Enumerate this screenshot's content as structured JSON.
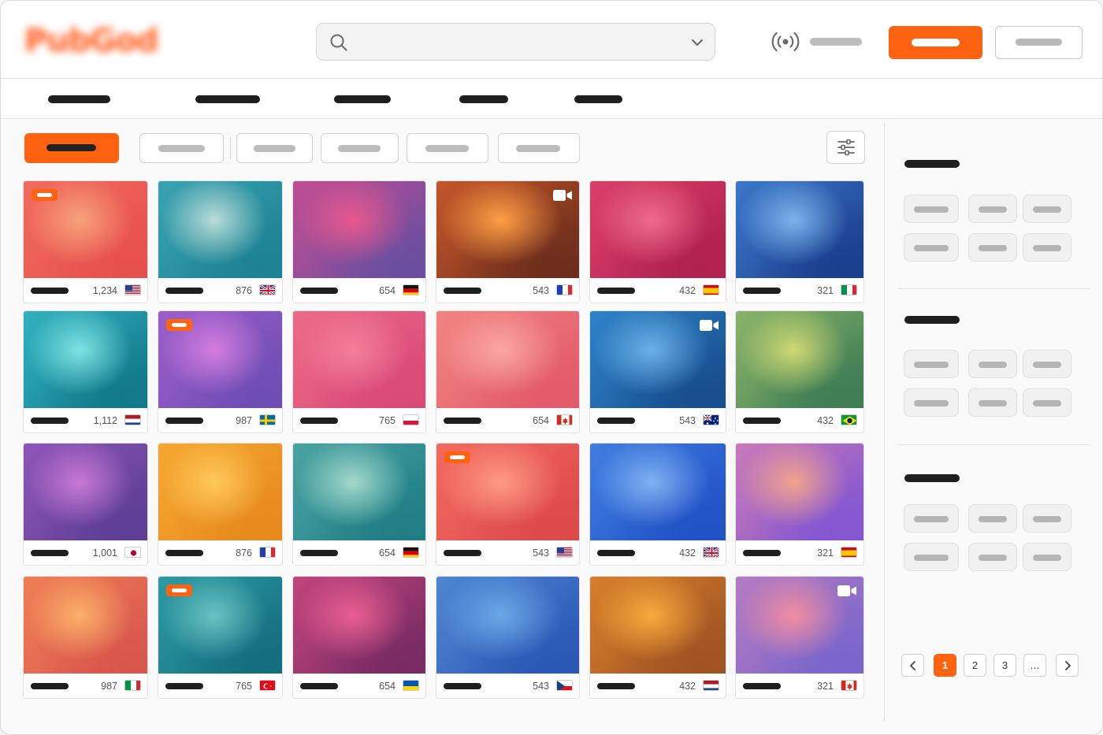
{
  "header": {
    "logo_text": "PubGod",
    "search": {
      "value": "",
      "placeholder": ""
    },
    "icons": {
      "search": "search-icon",
      "dropdown": "chevron-down-icon",
      "live": "live-broadcast-icon"
    }
  },
  "colors": {
    "accent": "#ff6310",
    "text_dark": "#1f1f1f",
    "muted": "#bdbdbd"
  },
  "grid": {
    "cards": [
      {
        "count": "1,234",
        "flag": "us",
        "badge": true,
        "camera": false,
        "g1": "#f7a27a",
        "g2": "#e8504e",
        "g3": "#f06b5e"
      },
      {
        "count": "876",
        "flag": "gb",
        "badge": false,
        "camera": false,
        "g1": "#b9dcd7",
        "g2": "#1d8394",
        "g3": "#3aa2b0"
      },
      {
        "count": "654",
        "flag": "de",
        "badge": false,
        "camera": false,
        "g1": "#e8588e",
        "g2": "#6b4fa0",
        "g3": "#c14d92"
      },
      {
        "count": "543",
        "flag": "fr",
        "badge": false,
        "camera": true,
        "g1": "#ff9f45",
        "g2": "#6e2e1c",
        "g3": "#c4562a"
      },
      {
        "count": "432",
        "flag": "es",
        "badge": false,
        "camera": false,
        "g1": "#ee6b8c",
        "g2": "#b1214d",
        "g3": "#d9406a"
      },
      {
        "count": "321",
        "flag": "it",
        "badge": false,
        "camera": false,
        "g1": "#7ab3ec",
        "g2": "#1b3f8f",
        "g3": "#3d78c9"
      },
      {
        "count": "1,112",
        "flag": "nl",
        "badge": false,
        "camera": false,
        "g1": "#7ee3e4",
        "g2": "#11798a",
        "g3": "#31b2be"
      },
      {
        "count": "987",
        "flag": "se",
        "badge": true,
        "camera": false,
        "g1": "#d57ddf",
        "g2": "#6e4eb4",
        "g3": "#9c5ecb"
      },
      {
        "count": "765",
        "flag": "pl",
        "badge": false,
        "camera": false,
        "g1": "#f47e9a",
        "g2": "#d94a76",
        "g3": "#ec6a88"
      },
      {
        "count": "654",
        "flag": "ca",
        "badge": false,
        "camera": false,
        "g1": "#fba7a2",
        "g2": "#e35b6b",
        "g3": "#f0847f"
      },
      {
        "count": "543",
        "flag": "au",
        "badge": false,
        "camera": true,
        "g1": "#6bb0e8",
        "g2": "#174f8d",
        "g3": "#2e83c9"
      },
      {
        "count": "432",
        "flag": "br",
        "badge": false,
        "camera": false,
        "g1": "#cfd873",
        "g2": "#3f7d55",
        "g3": "#8ab46a"
      },
      {
        "count": "1,001",
        "flag": "jp",
        "badge": false,
        "camera": false,
        "g1": "#c779d4",
        "g2": "#5e3f95",
        "g3": "#8d55b8"
      },
      {
        "count": "876",
        "flag": "fr",
        "badge": false,
        "camera": false,
        "g1": "#ffc95a",
        "g2": "#e88a1e",
        "g3": "#f5a831"
      },
      {
        "count": "654",
        "flag": "de",
        "badge": false,
        "camera": false,
        "g1": "#a3d9cc",
        "g2": "#1f7f85",
        "g3": "#4aa3a2"
      },
      {
        "count": "543",
        "flag": "us",
        "badge": true,
        "camera": false,
        "g1": "#ff9a83",
        "g2": "#dd4a4c",
        "g3": "#f36a60"
      },
      {
        "count": "432",
        "flag": "gb",
        "badge": false,
        "camera": false,
        "g1": "#7fb2f2",
        "g2": "#2152c6",
        "g3": "#3f7de0"
      },
      {
        "count": "321",
        "flag": "es",
        "badge": false,
        "camera": false,
        "g1": "#f2a38d",
        "g2": "#8456d2",
        "g3": "#c87ab9"
      },
      {
        "count": "987",
        "flag": "it",
        "badge": false,
        "camera": false,
        "g1": "#fcb06a",
        "g2": "#d9564d",
        "g3": "#ef7f55"
      },
      {
        "count": "765",
        "flag": "tr",
        "badge": true,
        "camera": false,
        "g1": "#6ac3c3",
        "g2": "#136f80",
        "g3": "#2e9aa3"
      },
      {
        "count": "654",
        "flag": "ua",
        "badge": false,
        "camera": false,
        "g1": "#ea5f92",
        "g2": "#7a2b63",
        "g3": "#c1457e"
      },
      {
        "count": "543",
        "flag": "cz",
        "badge": false,
        "camera": false,
        "g1": "#6aa8e6",
        "g2": "#2a58b6",
        "g3": "#4e86d2"
      },
      {
        "count": "432",
        "flag": "nl",
        "badge": false,
        "camera": false,
        "g1": "#f8aa3d",
        "g2": "#a05422",
        "g3": "#d67f2c"
      },
      {
        "count": "321",
        "flag": "ca",
        "badge": false,
        "camera": true,
        "g1": "#f28da0",
        "g2": "#7a66cc",
        "g3": "#b57bc1"
      }
    ]
  },
  "pagination": {
    "pages": [
      "1",
      "2",
      "3",
      "…"
    ],
    "current": "1",
    "icons": {
      "prev": "chevron-left-icon",
      "next": "chevron-right-icon"
    }
  }
}
